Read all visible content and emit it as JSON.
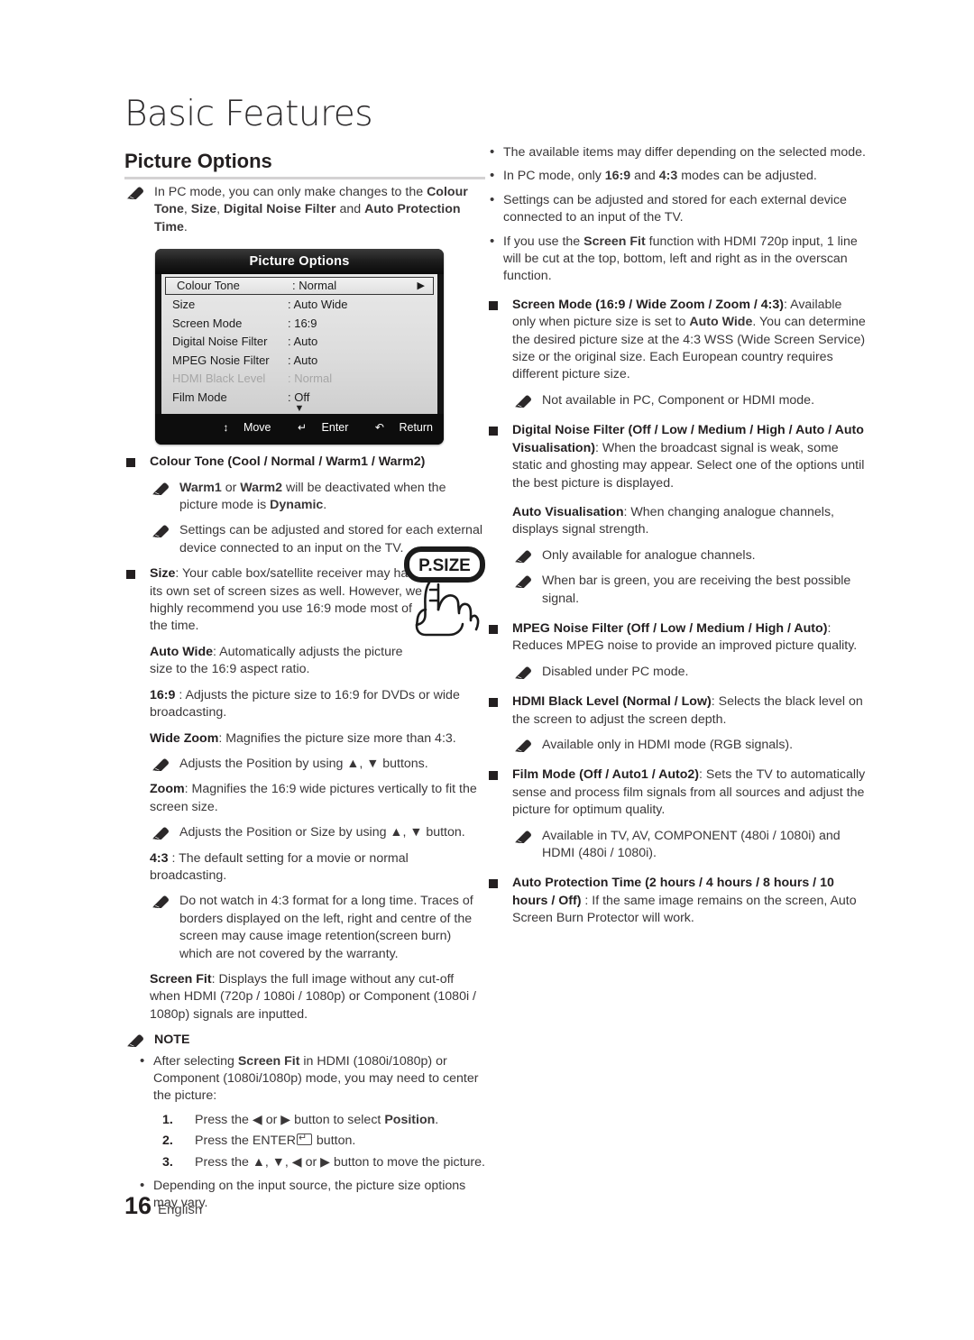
{
  "header": {
    "chapter": "Basic Features",
    "section": "Picture Options"
  },
  "left_column": {
    "intro_note": "In PC mode, you can only make changes to the Colour Tone, Size, Digital Noise Filter and Auto Protection Time.",
    "colour_tone_heading": "Colour Tone (Cool / Normal / Warm1 / Warm2)",
    "colour_tone_note1": "Warm1 or Warm2 will be deactivated when the picture mode is Dynamic.",
    "colour_tone_note2": "Settings can be adjusted and stored for each external device connected to an input on the TV.",
    "size_heading": "Size",
    "size_body": ": Your cable box/satellite receiver may have its own set of screen sizes as well. However, we highly recommend you use 16:9 mode most of the time.",
    "auto_wide_term": "Auto Wide",
    "auto_wide_body": ": Automatically adjusts the picture size to the 16:9 aspect ratio.",
    "ratio169_term": "16:9",
    "ratio169_body": " : Adjusts the picture size to 16:9 for DVDs or wide broadcasting.",
    "wide_zoom_term": "Wide Zoom",
    "wide_zoom_body": ": Magnifies the picture size more than 4:3.",
    "wide_zoom_note": "Adjusts the Position by using ▲, ▼ buttons.",
    "zoom_term": "Zoom",
    "zoom_body": ": Magnifies the 16:9 wide pictures vertically to fit the screen size.",
    "zoom_note": "Adjusts the Position or Size by using ▲, ▼ button.",
    "ratio43_term": "4:3",
    "ratio43_body": " : The default setting for a movie or normal broadcasting.",
    "ratio43_note": "Do not watch in 4:3 format for a long time. Traces of borders displayed on the left, right and centre of the screen may cause image retention(screen burn) which are not covered by the warranty.",
    "screen_fit_term": "Screen Fit",
    "screen_fit_body": ": Displays the full image without any cut-off when HDMI (720p / 1080i / 1080p) or Component (1080i / 1080p) signals are inputted.",
    "note_label": "NOTE",
    "note_bullet1_a": "After selecting ",
    "note_bullet1_b": "Screen Fit",
    "note_bullet1_c": " in HDMI (1080i/1080p) or Component (1080i/1080p) mode, you may need to center the picture:",
    "steps": [
      {
        "num": "1.",
        "a": "Press the ◀ or ▶ button to select ",
        "b": "Position",
        "c": "."
      },
      {
        "num": "2.",
        "a": "Press the ENTER",
        "b": "",
        "c": " button."
      },
      {
        "num": "3.",
        "a": "Press the ▲, ▼, ◀ or ▶ button to move the picture.",
        "b": "",
        "c": ""
      }
    ],
    "note_bullet2": "Depending on the input source, the picture size options may vary."
  },
  "osd": {
    "title": "Picture Options",
    "rows": [
      {
        "label": "Colour Tone",
        "value": ": Normal",
        "selected": true,
        "dim": false,
        "arrow": "▶"
      },
      {
        "label": "Size",
        "value": ": Auto Wide",
        "selected": false,
        "dim": false,
        "arrow": ""
      },
      {
        "label": "Screen Mode",
        "value": ": 16:9",
        "selected": false,
        "dim": false,
        "arrow": ""
      },
      {
        "label": "Digital Noise Filter",
        "value": ": Auto",
        "selected": false,
        "dim": false,
        "arrow": ""
      },
      {
        "label": "MPEG Nosie Filter",
        "value": ": Auto",
        "selected": false,
        "dim": false,
        "arrow": ""
      },
      {
        "label": "HDMI Black Level",
        "value": ": Normal",
        "selected": false,
        "dim": true,
        "arrow": ""
      },
      {
        "label": "Film Mode",
        "value": ": Off",
        "selected": false,
        "dim": false,
        "arrow": ""
      }
    ],
    "scroll_down_glyph": "▼",
    "footer": {
      "move": "Move",
      "enter": "Enter",
      "return": "Return",
      "move_glyph": "♦",
      "return_glyph": "↶"
    }
  },
  "psize_button": {
    "label": "P.SIZE"
  },
  "right_column": {
    "bullets": [
      {
        "a": "The available items may differ depending on the selected mode.",
        "b": "",
        "c": ""
      },
      {
        "a": "In PC mode, only ",
        "b": "16:9",
        "mid": " and ",
        "b2": "4:3",
        "c": " modes can be adjusted."
      },
      {
        "a": "Settings can be adjusted and stored for each external device connected to an input of the TV.",
        "b": "",
        "c": ""
      },
      {
        "a": "If you use the ",
        "b": "Screen Fit",
        "c": " function with HDMI 720p input, 1 line will be cut at the top, bottom, left and right as in the overscan function."
      }
    ],
    "screen_mode_heading": "Screen Mode (16:9 / Wide Zoom / Zoom / 4:3)",
    "screen_mode_body_a": ": Available only when picture size is set to ",
    "screen_mode_body_b": "Auto Wide",
    "screen_mode_body_c": ". You can determine the desired picture size at the 4:3 WSS (Wide Screen Service) size or the original size. Each European country requires different picture size.",
    "screen_mode_note": "Not available in PC, Component or HDMI mode.",
    "dnf_heading": "Digital Noise Filter (Off / Low / Medium / High / Auto / Auto Visualisation)",
    "dnf_body": ": When the broadcast signal is weak, some static and ghosting may appear. Select one of the options until the best picture is displayed.",
    "auto_vis_term": "Auto Visualisation",
    "auto_vis_body": ": When changing analogue channels, displays signal strength.",
    "auto_vis_note1": "Only available for analogue channels.",
    "auto_vis_note2": "When bar is green, you are receiving the best possible signal.",
    "mpeg_heading": "MPEG Noise Filter (Off / Low / Medium / High / Auto)",
    "mpeg_body": ": Reduces MPEG noise to provide an improved picture quality.",
    "mpeg_note": "Disabled under PC mode.",
    "hdmi_heading": "HDMI Black Level (Normal / Low)",
    "hdmi_body": ": Selects the black level on the screen to adjust the screen depth.",
    "hdmi_note": "Available only in HDMI mode (RGB signals).",
    "film_heading": "Film Mode (Off / Auto1 / Auto2)",
    "film_body": ": Sets the TV to automatically sense and process film signals from all sources and adjust the picture for optimum quality.",
    "film_note": "Available in TV, AV, COMPONENT (480i / 1080i) and HDMI (480i / 1080i).",
    "apt_heading": "Auto Protection Time (2 hours / 4 hours / 8 hours / 10 hours / Off)",
    "apt_body": " : If the same image remains on the screen, Auto Screen Burn Protector will work."
  },
  "footer": {
    "page_number": "16",
    "language": "English"
  }
}
